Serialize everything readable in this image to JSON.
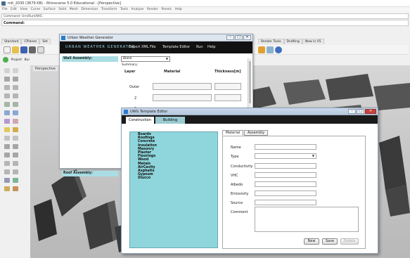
{
  "rhino": {
    "title": "mit_2030 (3679 KB) - Rhinoceros 5.0 Educational - [Perspective]",
    "menu": [
      "File",
      "Edit",
      "View",
      "Curve",
      "Surface",
      "Solid",
      "Mesh",
      "Dimension",
      "Transform",
      "Tools",
      "Analyze",
      "Render",
      "Panels",
      "Help"
    ],
    "command_history": "Command: UrniRunUWG",
    "command_prompt": "Command:",
    "tabs": [
      "Standard",
      "CPlanes",
      "Set"
    ],
    "tabs_right": [
      "Render Tools",
      "Drafting",
      "New in V5"
    ],
    "panel_tabs": [
      "Project",
      "Bui"
    ],
    "viewport_label": "Perspective"
  },
  "uwg": {
    "title": "Urban Weather Generator",
    "brand": "URBAN WEATHER GENERATOR",
    "menu": [
      "Export XML File",
      "Template Editor",
      "Run",
      "Help"
    ],
    "wall_assembly_label": "Wall Assembly:",
    "roof_assembly_label": "Roof Assembly:",
    "wall_select": "Blank",
    "summary_label": "Summary:",
    "columns": [
      "Layer",
      "Material",
      "Thickness[m]"
    ],
    "rows": [
      "Outer",
      "2",
      "3"
    ]
  },
  "template_editor": {
    "title": "UWG Template Editor",
    "tabs": [
      "Construction",
      "Building"
    ],
    "materials": [
      "Boards",
      "Roofings",
      "Concrete",
      "Insulation",
      "Masonry",
      "Plaster",
      "Floorings",
      "Wood",
      "Metals",
      "AirCavity",
      "Asphalts",
      "Gypsum",
      "Stucco"
    ],
    "prop_tabs": [
      "Material",
      "Assembly"
    ],
    "fields": [
      "Name",
      "Type",
      "Conductivity",
      "VHC",
      "Albedo",
      "Emissivity",
      "Source",
      "Comment"
    ],
    "buttons": [
      "New",
      "Save",
      "Delete"
    ]
  },
  "colors": {
    "cyan_panel": "#8fd6dc",
    "label_cell": "#a9dde3",
    "uwg_menu_bg": "#111111",
    "close_button": "#c8413a"
  },
  "icons": [
    "rhino-logo-icon",
    "uwg-app-icon",
    "minimize-icon",
    "maximize-icon",
    "close-icon",
    "dropdown-arrow-icon"
  ]
}
